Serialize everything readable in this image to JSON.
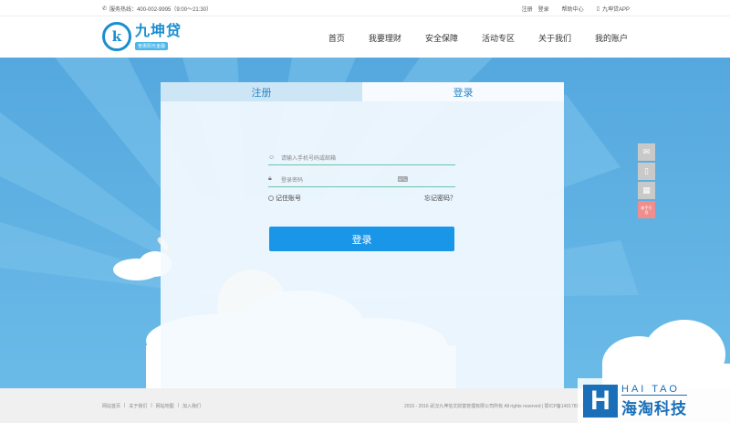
{
  "topbar": {
    "hotline": "服务热线：400-002-9995（9:00～21:30）",
    "register": "注册",
    "login": "登录",
    "help": "帮助中心",
    "app": "九坤贷APP"
  },
  "header": {
    "logo_name": "九坤贷",
    "logo_slogan": "普惠阳光金融",
    "nav": [
      "首页",
      "我要理财",
      "安全保障",
      "活动专区",
      "关于我们",
      "我的账户"
    ]
  },
  "form": {
    "tab_register": "注册",
    "tab_login": "登录",
    "username_placeholder": "请输入手机号码或邮箱",
    "password_placeholder": "登录密码",
    "remember": "记住账号",
    "forgot": "忘记密码？",
    "submit": "登录"
  },
  "sidetools": {
    "beginner": "新手引导"
  },
  "footer": {
    "links": [
      "网站首页",
      "|",
      "关于我们",
      "|",
      "网站地图",
      "|",
      "加入我们"
    ],
    "copyright": "2015 - 2016 武汉九坤信文财富管理有限公司所有 All rights reserved | 鄂ICP备14017891号"
  },
  "watermark": {
    "en": "HAI TAO",
    "cn": "海淘科技"
  },
  "colors": {
    "primary": "#1a96e8",
    "sky": "#5aaee0",
    "brand": "#1a8ed0"
  }
}
